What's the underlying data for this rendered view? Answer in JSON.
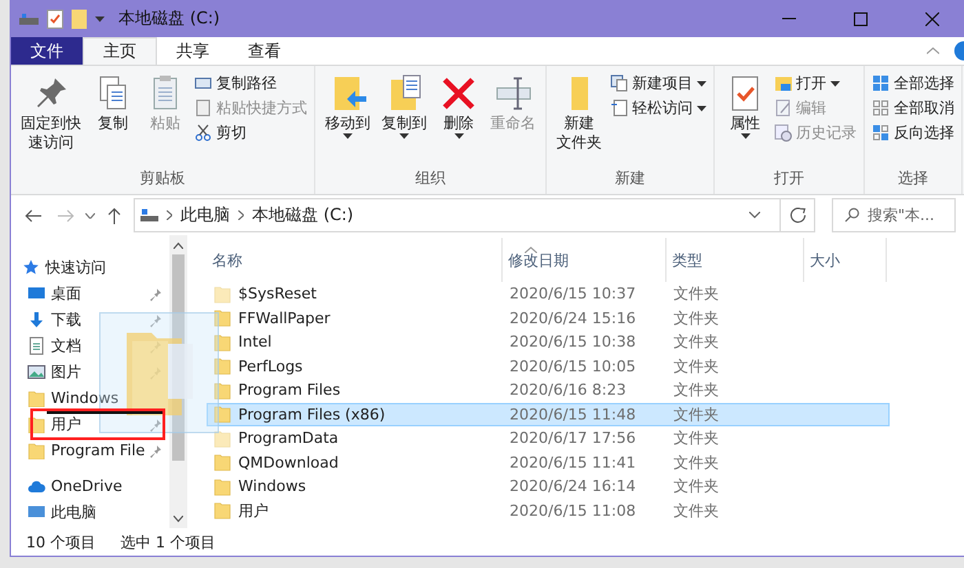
{
  "window": {
    "title": "本地磁盘 (C:)"
  },
  "ribbon": {
    "tabs": [
      {
        "label": "文件",
        "kind": "file",
        "selected": false
      },
      {
        "label": "主页",
        "kind": "tab",
        "selected": true
      },
      {
        "label": "共享",
        "kind": "tab",
        "selected": false
      },
      {
        "label": "查看",
        "kind": "tab",
        "selected": false
      }
    ],
    "groups": [
      {
        "label": "剪贴板",
        "large": [
          {
            "lines": [
              "固定到快",
              "速访问"
            ],
            "disabled": false,
            "dropdown": false
          },
          {
            "lines": [
              "复制"
            ],
            "disabled": false,
            "dropdown": false
          },
          {
            "lines": [
              "粘贴"
            ],
            "disabled": true,
            "dropdown": false
          }
        ],
        "small": [
          {
            "label": "复制路径",
            "disabled": false,
            "dropdown": false
          },
          {
            "label": "粘贴快捷方式",
            "disabled": true,
            "dropdown": false
          },
          {
            "label": "剪切",
            "disabled": false,
            "dropdown": false
          }
        ]
      },
      {
        "label": "组织",
        "large": [
          {
            "lines": [
              "移动到"
            ],
            "disabled": false,
            "dropdown": true
          },
          {
            "lines": [
              "复制到"
            ],
            "disabled": false,
            "dropdown": true
          },
          {
            "lines": [
              "删除"
            ],
            "disabled": false,
            "dropdown": true
          },
          {
            "lines": [
              "重命名"
            ],
            "disabled": true,
            "dropdown": false
          }
        ]
      },
      {
        "label": "新建",
        "large": [
          {
            "lines": [
              "新建",
              "文件夹"
            ],
            "disabled": false,
            "dropdown": false
          }
        ],
        "small": [
          {
            "label": "新建项目",
            "disabled": false,
            "dropdown": true
          },
          {
            "label": "轻松访问",
            "disabled": false,
            "dropdown": true
          }
        ]
      },
      {
        "label": "打开",
        "large": [
          {
            "lines": [
              "属性"
            ],
            "disabled": false,
            "dropdown": true
          }
        ],
        "small": [
          {
            "label": "打开",
            "disabled": false,
            "dropdown": true
          },
          {
            "label": "编辑",
            "disabled": true,
            "dropdown": false
          },
          {
            "label": "历史记录",
            "disabled": true,
            "dropdown": false
          }
        ]
      },
      {
        "label": "选择",
        "small": [
          {
            "label": "全部选择",
            "disabled": false,
            "dropdown": false
          },
          {
            "label": "全部取消",
            "disabled": false,
            "dropdown": false
          },
          {
            "label": "反向选择",
            "disabled": false,
            "dropdown": false
          }
        ]
      }
    ]
  },
  "address": {
    "crumbs": [
      "此电脑",
      "本地磁盘 (C:)"
    ],
    "search": {
      "placeholder": "搜索\"本..."
    }
  },
  "nav": {
    "items": [
      {
        "label": "快速访问",
        "kind": "header",
        "pinned": false
      },
      {
        "label": "桌面",
        "kind": "desktop",
        "pinned": true
      },
      {
        "label": "下载",
        "kind": "download",
        "pinned": true
      },
      {
        "label": "文档",
        "kind": "document",
        "pinned": true
      },
      {
        "label": "图片",
        "kind": "pictures",
        "pinned": true
      },
      {
        "label": "Windows",
        "kind": "folder",
        "pinned": false
      },
      {
        "label": "用户",
        "kind": "folder",
        "pinned": true
      },
      {
        "label": "Program File",
        "kind": "folder",
        "pinned": true
      },
      {
        "label": "OneDrive",
        "kind": "cloud",
        "pinned": false
      },
      {
        "label": "此电脑",
        "kind": "pc",
        "pinned": false
      }
    ]
  },
  "table": {
    "columns": [
      "名称",
      "修改日期",
      "类型",
      "大小"
    ],
    "rows": [
      {
        "name": "$SysReset",
        "date": "2020/6/15 10:37",
        "type": "文件夹",
        "hidden": true,
        "selected": false
      },
      {
        "name": "FFWallPaper",
        "date": "2020/6/24 15:16",
        "type": "文件夹",
        "hidden": false,
        "selected": false
      },
      {
        "name": "Intel",
        "date": "2020/6/15 10:38",
        "type": "文件夹",
        "hidden": false,
        "selected": false
      },
      {
        "name": "PerfLogs",
        "date": "2020/6/15 10:05",
        "type": "文件夹",
        "hidden": false,
        "selected": false
      },
      {
        "name": "Program Files",
        "date": "2020/6/16 8:23",
        "type": "文件夹",
        "hidden": false,
        "selected": false
      },
      {
        "name": "Program Files (x86)",
        "date": "2020/6/15 11:48",
        "type": "文件夹",
        "hidden": false,
        "selected": true
      },
      {
        "name": "ProgramData",
        "date": "2020/6/17 17:56",
        "type": "文件夹",
        "hidden": true,
        "selected": false
      },
      {
        "name": "QMDownload",
        "date": "2020/6/15 11:41",
        "type": "文件夹",
        "hidden": false,
        "selected": false
      },
      {
        "name": "Windows",
        "date": "2020/6/24 16:14",
        "type": "文件夹",
        "hidden": false,
        "selected": false
      },
      {
        "name": "用户",
        "date": "2020/6/15 11:08",
        "type": "文件夹",
        "hidden": false,
        "selected": false
      }
    ]
  },
  "status_bar": {
    "count": "10 个项目",
    "selection": "选中 1 个项目"
  }
}
